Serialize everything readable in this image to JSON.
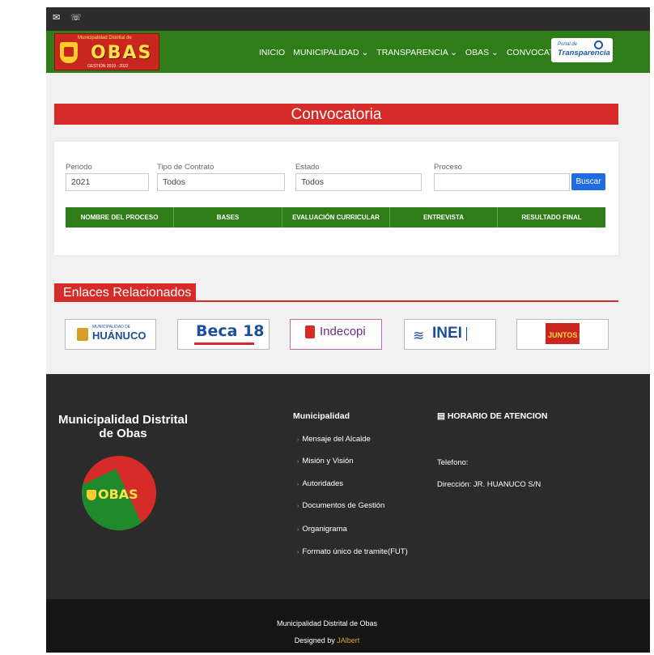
{
  "topbar": {
    "mail_icon": "✉",
    "phone_icon": "☏"
  },
  "header": {
    "logo": {
      "tagline": "Municipalidad Distrital de",
      "name": "OBAS",
      "years": "GESTIÓN 2019 - 2022"
    },
    "nav": [
      "INICIO",
      "MUNICIPALIDAD ⌄",
      "TRANSPARENCIA ⌄",
      "OBAS ⌄",
      "CONVOCATORIA"
    ],
    "portal": {
      "line1": "Portal de",
      "line2": "Transparencia"
    }
  },
  "page": {
    "title": "Convocatoria"
  },
  "filters": {
    "periodo": {
      "label": "Periodo",
      "value": "2021"
    },
    "tipo": {
      "label": "Tipo de Contrato",
      "value": "Todos"
    },
    "estado": {
      "label": "Estado",
      "value": "Todos"
    },
    "proceso": {
      "label": "Proceso",
      "value": ""
    },
    "search_button": "Buscar"
  },
  "table": {
    "columns": [
      "NOMBRE DEL PROCESO",
      "BASES",
      "EVALUACIÓN CURRICULAR",
      "ENTREVISTA",
      "RESULTADO FINAL"
    ]
  },
  "related": {
    "title": "Enlaces Relacionados",
    "links": [
      {
        "name": "HUÁNUCO",
        "sub": "MUNICIPALIDAD DE",
        "color": "#1b4f9c"
      },
      {
        "name": "Beca 18",
        "color": "#1b4f9c"
      },
      {
        "name": "Indecopi",
        "color": "#6b2c8f"
      },
      {
        "name": "INEI",
        "color": "#1b4f9c"
      },
      {
        "name": "JUNTOS",
        "color": "#c8261f"
      }
    ]
  },
  "footer": {
    "brand": "Municipalidad Distrital de Obas",
    "logo_word": "OBAS",
    "municipalidad": {
      "title": "Municipalidad",
      "links": [
        "Mensaje del Alcalde",
        "Misión y Visión",
        "Autoridades",
        "Documentos de Gestión",
        "Organigrama",
        "Formato único de tramite(FUT)"
      ]
    },
    "horario": {
      "title": "HORARIO DE ATENCION",
      "telefono": "Telefono:",
      "direccion": "Dirección: JR. HUANUCO S/N"
    },
    "bottom": {
      "line1": "Municipalidad Distrital de Obas",
      "designed_by": "Designed by ",
      "author": "JAlbert"
    }
  }
}
